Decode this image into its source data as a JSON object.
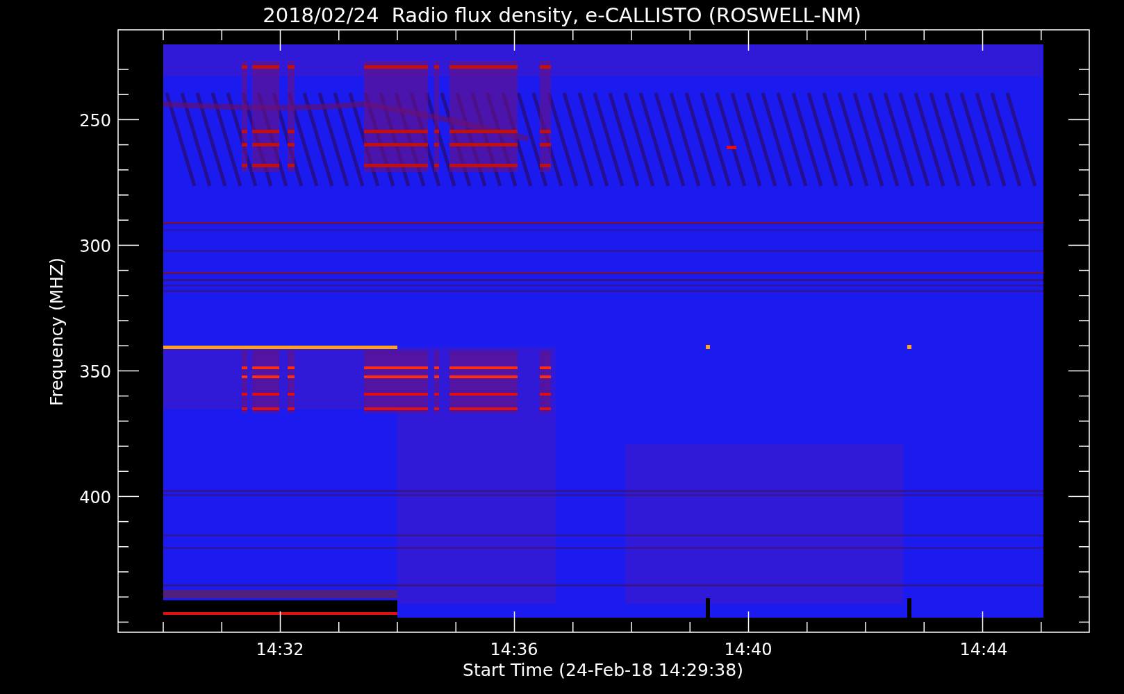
{
  "chart": {
    "title": "2018/02/24  Radio flux density, e-CALLISTO (ROSWELL-NM)",
    "xlabel": "Start Time (24-Feb-18 14:29:38)",
    "ylabel": "Frequency (MHZ)",
    "yticks": [
      "250",
      "300",
      "350",
      "400"
    ],
    "xticks": [
      "14:32",
      "14:36",
      "14:40",
      "14:44"
    ]
  }
}
